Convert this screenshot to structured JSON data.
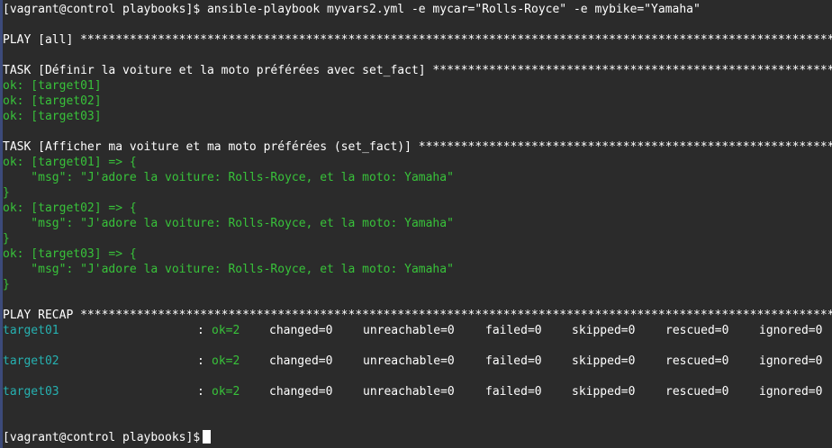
{
  "colors": {
    "background": "#2b2b2b",
    "text": "#ffffff",
    "ok": "#38c23a",
    "host": "#26b1b1"
  },
  "command_line": "[vagrant@control playbooks]$ ansible-playbook myvars2.yml -e mycar=\"Rolls-Royce\" -e mybike=\"Yamaha\"",
  "play_header": "PLAY [all] **********************************************************************************************************************",
  "task1_header": "TASK [Définir la voiture et la moto préférées avec set_fact] *******************************************************************",
  "task1_results": [
    "ok: [target01]",
    "ok: [target02]",
    "ok: [target03]"
  ],
  "task2_header": "TASK [Afficher ma voiture et ma moto préférées (set_fact)] **********************************************************************",
  "task2_results": [
    {
      "head": "ok: [target01] => {",
      "msg": "    \"msg\": \"J'adore la voiture: Rolls-Royce, et la moto: Yamaha\"",
      "close": "}"
    },
    {
      "head": "ok: [target02] => {",
      "msg": "    \"msg\": \"J'adore la voiture: Rolls-Royce, et la moto: Yamaha\"",
      "close": "}"
    },
    {
      "head": "ok: [target03] => {",
      "msg": "    \"msg\": \"J'adore la voiture: Rolls-Royce, et la moto: Yamaha\"",
      "close": "}"
    }
  ],
  "recap_header": "PLAY RECAP **********************************************************************************************************************",
  "recap": [
    {
      "host": "target01",
      "sep": ":",
      "ok": "ok=2",
      "changed": "changed=0",
      "unreachable": "unreachable=0",
      "failed": "failed=0",
      "skipped": "skipped=0",
      "rescued": "rescued=0",
      "ignored": "ignored=0"
    },
    {
      "host": "target02",
      "sep": ":",
      "ok": "ok=2",
      "changed": "changed=0",
      "unreachable": "unreachable=0",
      "failed": "failed=0",
      "skipped": "skipped=0",
      "rescued": "rescued=0",
      "ignored": "ignored=0"
    },
    {
      "host": "target03",
      "sep": ":",
      "ok": "ok=2",
      "changed": "changed=0",
      "unreachable": "unreachable=0",
      "failed": "failed=0",
      "skipped": "skipped=0",
      "rescued": "rescued=0",
      "ignored": "ignored=0"
    }
  ],
  "prompt": "[vagrant@control playbooks]$"
}
